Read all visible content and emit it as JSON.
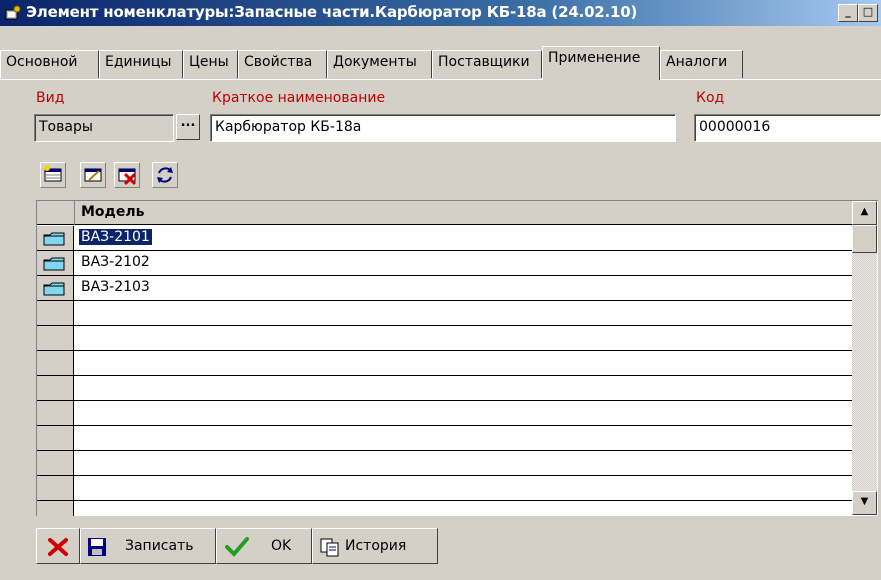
{
  "window": {
    "title": "Элемент номенклатуры:Запасные части.Карбюратор КБ-18а (24.02.10)",
    "controls": [
      "_",
      "□",
      "×"
    ]
  },
  "tabs": [
    {
      "label": "Основной",
      "active": false
    },
    {
      "label": "Единицы",
      "active": false
    },
    {
      "label": "Цены",
      "active": false
    },
    {
      "label": "Свойства",
      "active": false
    },
    {
      "label": "Документы",
      "active": false
    },
    {
      "label": "Поставщики",
      "active": false
    },
    {
      "label": "Применение",
      "active": true
    },
    {
      "label": "Аналоги",
      "active": false
    }
  ],
  "form": {
    "vid_label": "Вид",
    "vid_value": "Товары",
    "vid_button": "...",
    "name_label": "Краткое наименование",
    "name_value": "Карбюратор КБ-18а",
    "code_label": "Код",
    "code_value": "00000016"
  },
  "toolbar": {
    "icons": [
      "new-row-icon",
      "edit-row-icon",
      "delete-row-icon",
      "refresh-icon"
    ]
  },
  "grid": {
    "column": "Модель",
    "rows": [
      {
        "value": "ВАЗ-2101",
        "selected": true
      },
      {
        "value": "ВАЗ-2102",
        "selected": false
      },
      {
        "value": "ВАЗ-2103",
        "selected": false
      }
    ]
  },
  "buttons": {
    "delete_icon": "red-x-icon",
    "save_label": "Записать",
    "ok_label": "OK",
    "history_label": "История"
  },
  "colors": {
    "title_bar": "#0a246a",
    "selection": "#0a246a",
    "label_red": "#c00000",
    "face": "#d4d0c8"
  }
}
